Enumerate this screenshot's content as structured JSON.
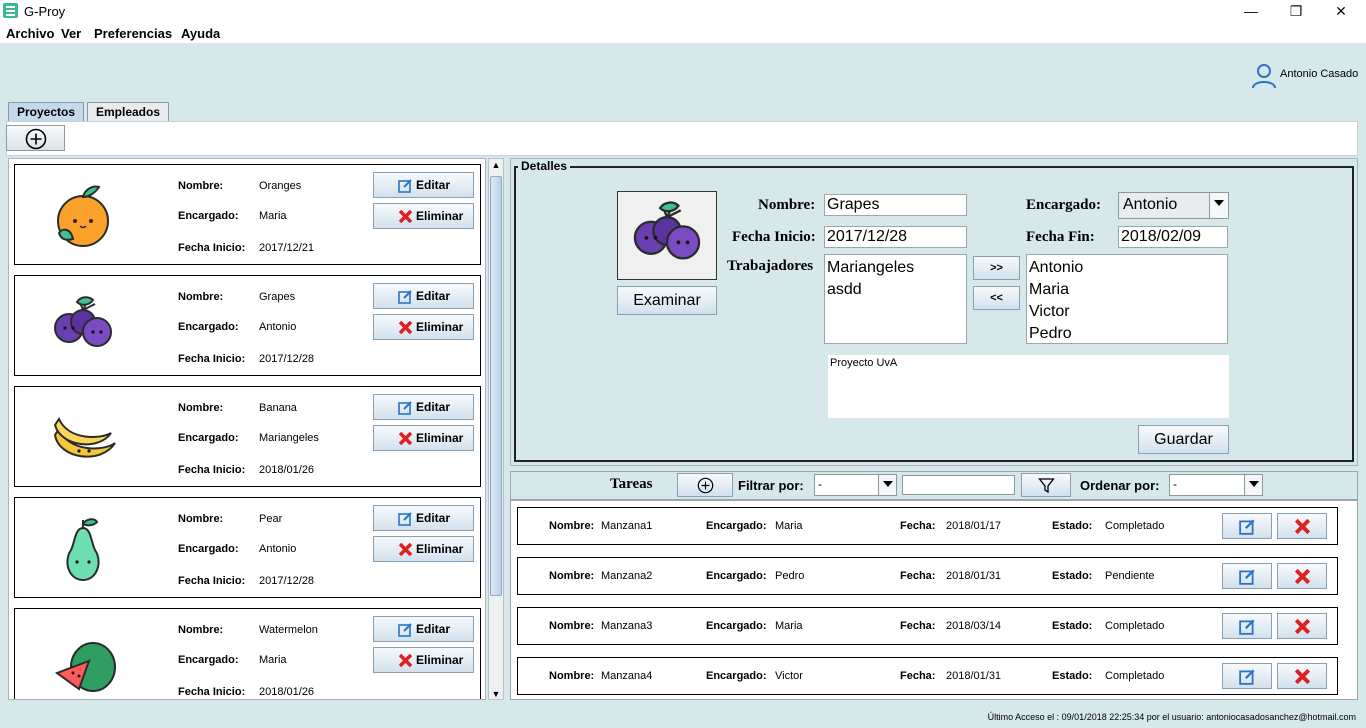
{
  "window": {
    "title": "G-Proy",
    "controls": {
      "minimize": "—",
      "maximize": "❐",
      "close": "✕"
    }
  },
  "menu": {
    "items": [
      "Archivo",
      "Ver",
      "Preferencias",
      "Ayuda"
    ]
  },
  "user": {
    "name": "Antonio Casado",
    "icon": "user-icon"
  },
  "tabs": [
    {
      "label": "Proyectos",
      "active": true
    },
    {
      "label": "Empleados",
      "active": false
    }
  ],
  "project_labels": {
    "nombre": "Nombre:",
    "encargado": "Encargado:",
    "fecha_inicio": "Fecha Inicio:",
    "editar": "Editar",
    "eliminar": "Eliminar"
  },
  "projects": [
    {
      "nombre": "Oranges",
      "encargado": "Maria",
      "fecha_inicio": "2017/12/21",
      "icon": "orange-icon"
    },
    {
      "nombre": "Grapes",
      "encargado": "Antonio",
      "fecha_inicio": "2017/12/28",
      "icon": "grapes-icon"
    },
    {
      "nombre": "Banana",
      "encargado": "Mariangeles",
      "fecha_inicio": "2018/01/26",
      "icon": "banana-icon"
    },
    {
      "nombre": "Pear",
      "encargado": "Antonio",
      "fecha_inicio": "2017/12/28",
      "icon": "pear-icon"
    },
    {
      "nombre": "Watermelon",
      "encargado": "Maria",
      "fecha_inicio": "2018/01/26",
      "icon": "watermelon-icon"
    }
  ],
  "details": {
    "title": "Detalles",
    "image_icon": "grapes-icon",
    "examinar": "Examinar",
    "nombre_label": "Nombre:",
    "nombre": "Grapes",
    "fecha_inicio_label": "Fecha Inicio:",
    "fecha_inicio": "2017/12/28",
    "trabajadores_label": "Trabajadores",
    "trabajadores": [
      "Mariangeles",
      "asdd"
    ],
    "encargado_label": "Encargado:",
    "encargado": "Antonio",
    "fecha_fin_label": "Fecha Fin:",
    "fecha_fin": "2018/02/09",
    "add_btn": ">>",
    "remove_btn": "<<",
    "disponibles": [
      "Antonio",
      "Maria",
      "Victor",
      "Pedro"
    ],
    "descripcion": "Proyecto UvA",
    "guardar": "Guardar"
  },
  "tareas": {
    "title": "Tareas",
    "filtrar_label": "Filtrar por:",
    "filtrar_value": "-",
    "filter_text": "",
    "ordenar_label": "Ordenar por:",
    "ordenar_value": "-",
    "labels": {
      "nombre": "Nombre:",
      "encargado": "Encargado:",
      "fecha": "Fecha:",
      "estado": "Estado:"
    },
    "items": [
      {
        "nombre": "Manzana1",
        "encargado": "Maria",
        "fecha": "2018/01/17",
        "estado": "Completado"
      },
      {
        "nombre": "Manzana2",
        "encargado": "Pedro",
        "fecha": "2018/01/31",
        "estado": "Pendiente"
      },
      {
        "nombre": "Manzana3",
        "encargado": "Maria",
        "fecha": "2018/03/14",
        "estado": "Completado"
      },
      {
        "nombre": "Manzana4",
        "encargado": "Victor",
        "fecha": "2018/01/31",
        "estado": "Completado"
      }
    ]
  },
  "status": {
    "text": "Último Acceso el : 09/01/2018 22:25:34 por el usuario: antoniocasadosanchez@hotmail.com"
  },
  "colors": {
    "background": "#d6e8ea",
    "edit_blue": "#2a74c9",
    "delete_red": "#e02020"
  }
}
